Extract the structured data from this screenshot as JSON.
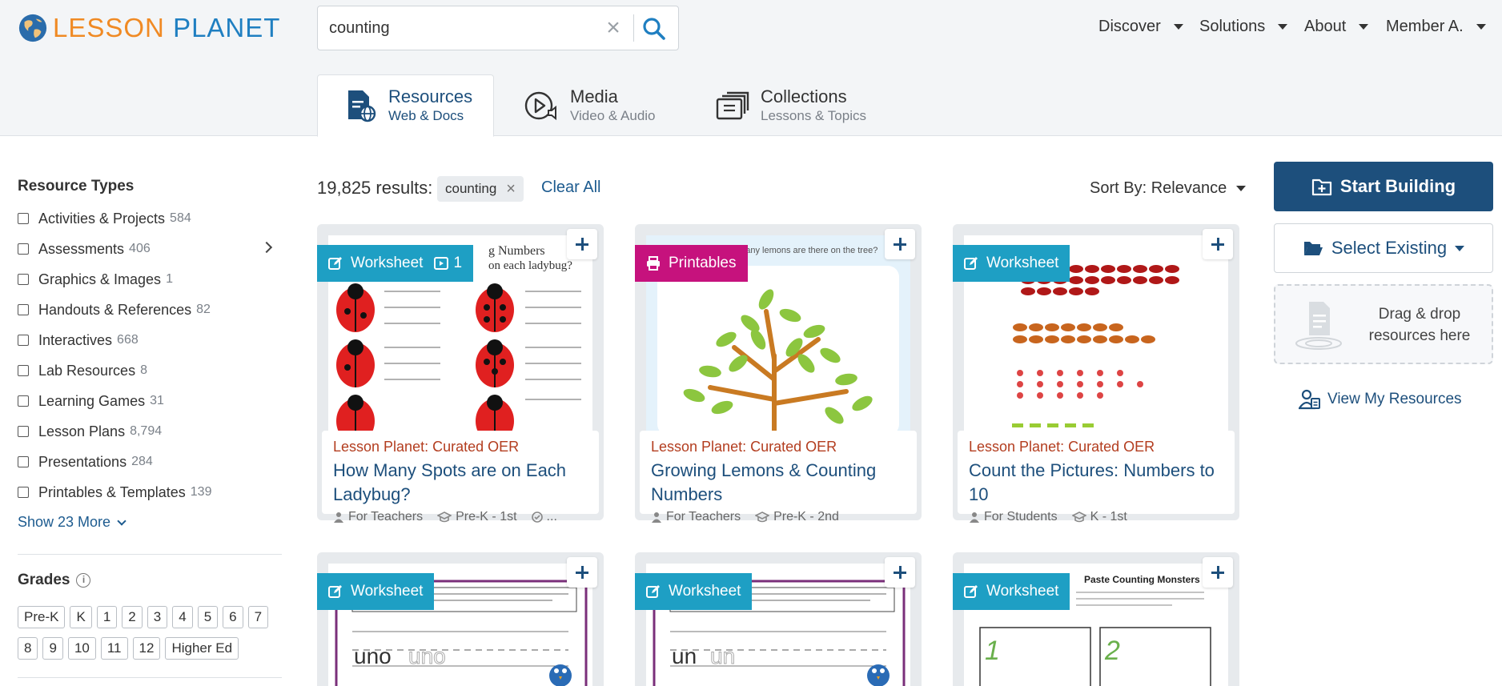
{
  "brand": {
    "lesson": "LESSON",
    "planet": "PLANET"
  },
  "search": {
    "value": "counting",
    "placeholder": ""
  },
  "nav": [
    {
      "label": "Discover"
    },
    {
      "label": "Solutions"
    },
    {
      "label": "About"
    },
    {
      "label": "Member A."
    }
  ],
  "tabs": [
    {
      "title": "Resources",
      "sub": "Web & Docs"
    },
    {
      "title": "Media",
      "sub": "Video & Audio"
    },
    {
      "title": "Collections",
      "sub": "Lessons & Topics"
    }
  ],
  "sidebar": {
    "resource_types_heading": "Resource Types",
    "resource_types": [
      {
        "label": "Activities & Projects",
        "count": "584"
      },
      {
        "label": "Assessments",
        "count": "406"
      },
      {
        "label": "Graphics & Images",
        "count": "1"
      },
      {
        "label": "Handouts & References",
        "count": "82"
      },
      {
        "label": "Interactives",
        "count": "668"
      },
      {
        "label": "Lab Resources",
        "count": "8"
      },
      {
        "label": "Learning Games",
        "count": "31"
      },
      {
        "label": "Lesson Plans",
        "count": "8,794"
      },
      {
        "label": "Presentations",
        "count": "284"
      },
      {
        "label": "Printables & Templates",
        "count": "139"
      }
    ],
    "show_more": "Show 23 More",
    "grades_heading": "Grades",
    "grades_row1": [
      "Pre-K",
      "K",
      "1",
      "2",
      "3",
      "4",
      "5",
      "6",
      "7"
    ],
    "grades_row2": [
      "8",
      "9",
      "10",
      "11",
      "12",
      "Higher Ed"
    ]
  },
  "results": {
    "count_label": "19,825 results:",
    "chip": "counting",
    "clear_all": "Clear All",
    "sort_label": "Sort By: Relevance"
  },
  "cards": [
    {
      "badge": "Worksheet",
      "badge_extra": "1",
      "source": "Lesson Planet: Curated OER",
      "title": "How Many Spots are on Each Ladybug?",
      "audience": "For Teachers",
      "grade": "Pre-K - 1st",
      "extra": "..."
    },
    {
      "badge": "Printables",
      "source": "Lesson Planet: Curated OER",
      "title": "Growing Lemons & Counting Numbers",
      "audience": "For Teachers",
      "grade": "Pre-K - 2nd"
    },
    {
      "badge": "Worksheet",
      "source": "Lesson Planet: Curated OER",
      "title": "Count the Pictures: Numbers to 10",
      "audience": "For Students",
      "grade": "K - 1st"
    },
    {
      "badge": "Worksheet"
    },
    {
      "badge": "Worksheet"
    },
    {
      "badge": "Worksheet"
    }
  ],
  "thumb_text": {
    "ladybug_title": "g Numbers",
    "ladybug_sub": "on each ladybug?",
    "lemons_q": "How many lemons are there on the tree?",
    "spanish_word": "uno",
    "french_word": "un",
    "monsters_title": "Paste Counting Monsters",
    "num1": "1",
    "num2": "2"
  },
  "panel": {
    "start_building": "Start Building",
    "select_existing": "Select Existing",
    "drop_text": "Drag & drop resources here",
    "view_mine": "View My Resources"
  },
  "colors": {
    "primary": "#1d4f7c",
    "worksheet_badge": "#1e9fc4",
    "printables_badge": "#c6127d",
    "oer_text": "#b33d1f",
    "logo_orange": "#f08a24",
    "logo_blue": "#1f7fc1"
  }
}
